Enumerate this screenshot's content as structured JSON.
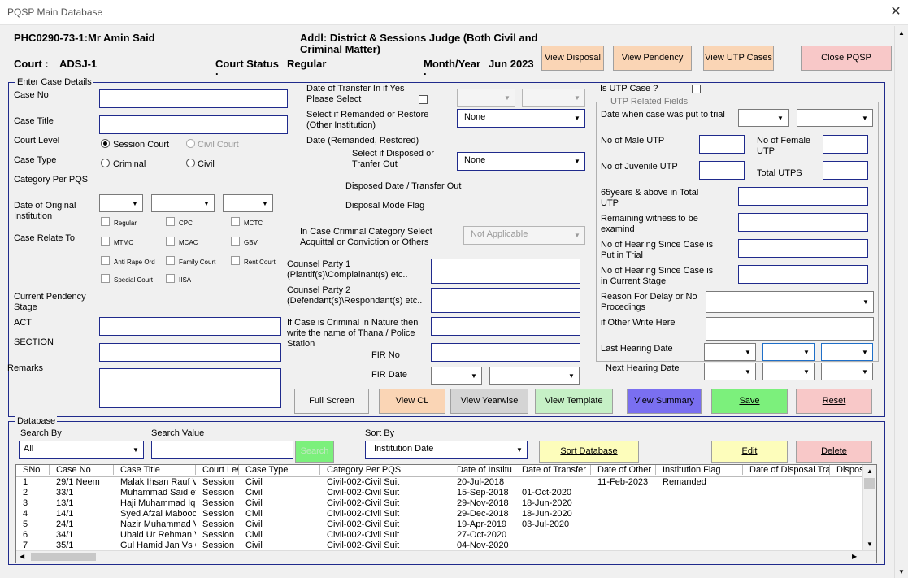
{
  "window": {
    "title": "PQSP Main Database",
    "close": "✕"
  },
  "header": {
    "judge": "PHC0290-73-1:Mr Amin Said",
    "designation_line1": "Addl: District & Sessions Judge (Both Civil and",
    "designation_line2": "Criminal Matter)",
    "court_label": "Court :",
    "court_value": "ADSJ-1",
    "status_label": "Court Status",
    "status_value": "Regular",
    "month_label": "Month/Year",
    "month_value": "Jun 2023",
    "dot": "."
  },
  "top_buttons": {
    "view_disposal": "View Disposal",
    "view_pendency": "View Pendency",
    "view_utp": "View UTP Cases",
    "close": "Close PQSP"
  },
  "colors": {
    "frame": "#1f2a8c",
    "peach": "#fad5b5",
    "pink": "#f8c8c8",
    "green": "#7cf07c",
    "lightgreen": "#c6f0c6",
    "purple": "#7a6ff0",
    "yellow": "#fdfdbb",
    "grey": "#d4d4d4"
  },
  "case": {
    "legend": "Enter Case Details",
    "case_no": "Case No",
    "case_title": "Case Title",
    "court_level": "Court Level",
    "session_court": "Session Court",
    "civil_court": "Civil Court",
    "case_type": "Case Type",
    "criminal": "Criminal",
    "civil": "Civil",
    "category": "Category Per PQS",
    "date_original_1": "Date of Original",
    "date_original_2": "Institution",
    "case_relate": "Case Relate To",
    "relate": {
      "regular": "Regular",
      "cpc": "CPC",
      "mctc": "MCTC",
      "mtmc": "MTMC",
      "mcac": "MCAC",
      "gbv": "GBV",
      "anti_rape": "Anti Rape Ord",
      "family": "Family Court",
      "rent": "Rent Court",
      "special": "Special Court",
      "iisa": "IISA"
    },
    "pendency_1": "Current Pendency",
    "pendency_2": "Stage",
    "act": "ACT",
    "section": "SECTION",
    "remarks": "Remarks",
    "transfer_1": "Date of Transfer In if Yes",
    "transfer_2": "Please Select",
    "remanded_1": "Select if Remanded or Restore",
    "remanded_2": "(Other Institution)",
    "remanded_value": "None",
    "date_remanded": "Date (Remanded, Restored)",
    "disposed_1": "Select if Disposed or",
    "disposed_2": "Tranfer Out",
    "disposed_value": "None",
    "disposed_date": "Disposed Date / Transfer Out",
    "disposal_mode": "Disposal Mode Flag",
    "criminal_cat_1": "In Case Criminal Category Select",
    "criminal_cat_2": "Acquittal or Conviction or Others",
    "criminal_cat_value": "Not Applicable",
    "counsel1_1": "Counsel Party 1",
    "counsel1_2": "(Plantif(s)\\Complainant(s) etc..",
    "counsel2_1": "Counsel Party 2",
    "counsel2_2": "(Defendant(s)\\Respondant(s) etc..",
    "thana_1": "If Case is Criminal in Nature then",
    "thana_2": "write the name of Thana / Police",
    "thana_3": "Station",
    "fir_no": "FIR No",
    "fir_date": "FIR Date",
    "utp_q": "Is UTP Case ?",
    "utp_legend": "UTP Related Fields",
    "date_trial": "Date when case was put to trial",
    "male_utp": "No of Male UTP",
    "female_utp_1": "No of Female",
    "female_utp_2": "UTP",
    "juvenile_utp": "No of Juvenile UTP",
    "total_utps": "Total UTPS",
    "above65_1": "65years & above in Total",
    "above65_2": "UTP",
    "witness_1": "Remaining witness to be",
    "witness_2": "examind",
    "hearing_trial_1": "No of Hearing Since Case is",
    "hearing_trial_2": "Put in Trial",
    "hearing_stage_1": "No of Hearing Since Case is",
    "hearing_stage_2": "in Current Stage",
    "delay_1": "Reason For Delay or No",
    "delay_2": "Procedings",
    "other": "if Other Write Here",
    "last_hearing": "Last Hearing Date",
    "next_hearing": "Next Hearing Date"
  },
  "action_buttons": {
    "full_screen": "Full Screen",
    "view_cl": "View CL",
    "view_yearwise": "View Yearwise",
    "view_template": "View Template",
    "view_summary": "View Summary",
    "save": "Save",
    "reset": "Reset"
  },
  "database": {
    "legend": "Database",
    "search_by": "Search By",
    "search_by_value": "All",
    "search_value": "Search Value",
    "search_button": "Search",
    "sort_by": "Sort By",
    "sort_by_value": "Institution Date",
    "sort_button": "Sort Database",
    "edit": "Edit",
    "delete": "Delete",
    "columns": [
      "SNo",
      "Case No",
      "Case Title",
      "Court Lev",
      "Case Type",
      "Category Per PQS",
      "Date of Institu",
      "Date of Transfer",
      "Date of Other",
      "Institution Flag",
      "Date of Disposal Tra",
      "Dispos"
    ],
    "rows": [
      [
        "1",
        "29/1 Neem",
        "Malak Ihsan Rauf V",
        "Session",
        "Civil",
        "Civil-002-Civil Suit",
        "20-Jul-2018",
        "",
        "11-Feb-2023",
        "Remanded",
        "",
        ""
      ],
      [
        "2",
        "33/1",
        "Muhammad Said et",
        "Session",
        "Civil",
        "Civil-002-Civil Suit",
        "15-Sep-2018",
        "01-Oct-2020",
        "",
        "",
        "",
        ""
      ],
      [
        "3",
        "13/1",
        "Haji Muhammad Iql",
        "Session",
        "Civil",
        "Civil-002-Civil Suit",
        "29-Nov-2018",
        "18-Jun-2020",
        "",
        "",
        "",
        ""
      ],
      [
        "4",
        "14/1",
        "Syed Afzal Mabooc",
        "Session",
        "Civil",
        "Civil-002-Civil Suit",
        "29-Dec-2018",
        "18-Jun-2020",
        "",
        "",
        "",
        ""
      ],
      [
        "5",
        "24/1",
        "Nazir Muhammad V",
        "Session",
        "Civil",
        "Civil-002-Civil Suit",
        "19-Apr-2019",
        "03-Jul-2020",
        "",
        "",
        "",
        ""
      ],
      [
        "6",
        "34/1",
        "Ubaid Ur Rehman V",
        "Session",
        "Civil",
        "Civil-002-Civil Suit",
        "27-Oct-2020",
        "",
        "",
        "",
        "",
        ""
      ],
      [
        "7",
        "35/1",
        "Gul Hamid Jan Vs G",
        "Session",
        "Civil",
        "Civil-002-Civil Suit",
        "04-Nov-2020",
        "",
        "",
        "",
        "",
        ""
      ]
    ]
  }
}
